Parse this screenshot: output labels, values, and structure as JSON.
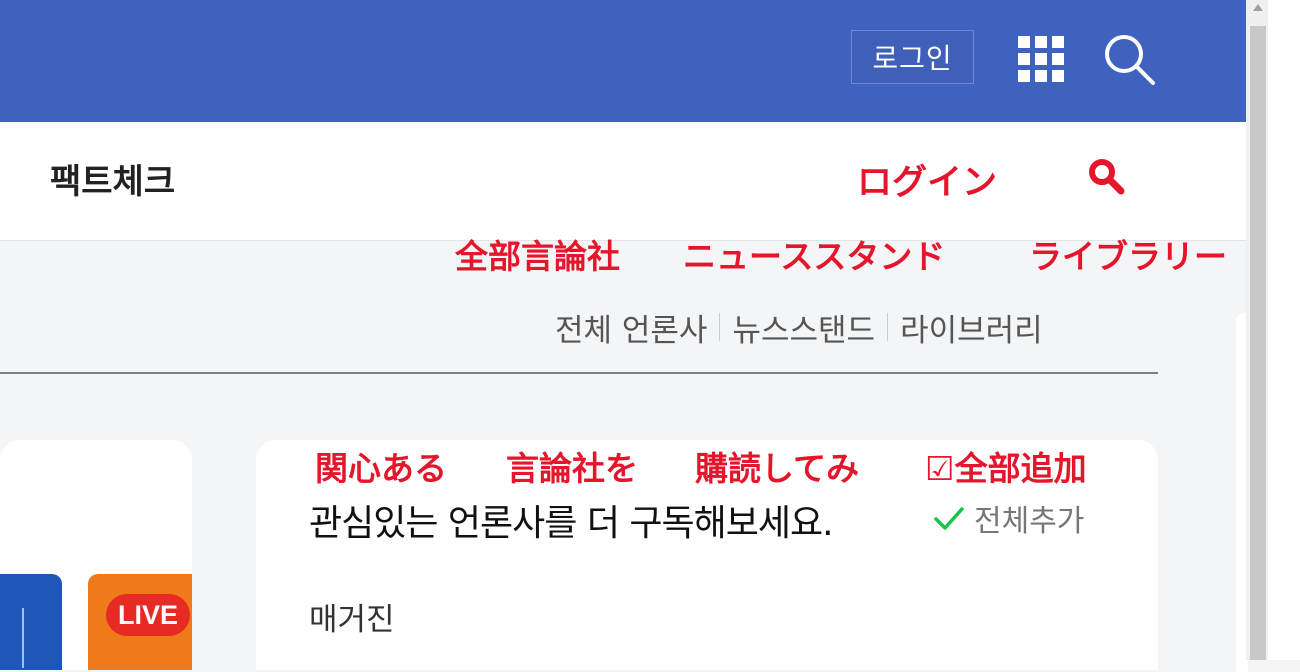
{
  "header": {
    "login_label": "로그인",
    "apps_icon": "grid-icon",
    "search_icon": "search-icon",
    "bg_color": "#4062bf"
  },
  "subnav": {
    "title": "팩트체크"
  },
  "overlay": {
    "login": "ログイン",
    "search_glyph": "🔍",
    "all_press": "全部言論社",
    "newsstand": "ニューススタンド",
    "library": "ライブラリー",
    "interest": "関心ある",
    "press_o": "言論社を",
    "subscribe": "購読してみ",
    "add_all": "☑全部追加",
    "color": "#e5162b"
  },
  "links": {
    "all_press": "전체 언론사",
    "newsstand": "뉴스스탠드",
    "library": "라이브러리"
  },
  "thumbs": {
    "live_badge": "LIVE"
  },
  "subscribe_card": {
    "title": "관심있는 언론사를 더 구독해보세요.",
    "add_all": "전체추가",
    "section": "매거진",
    "check_color": "#19c24a"
  }
}
